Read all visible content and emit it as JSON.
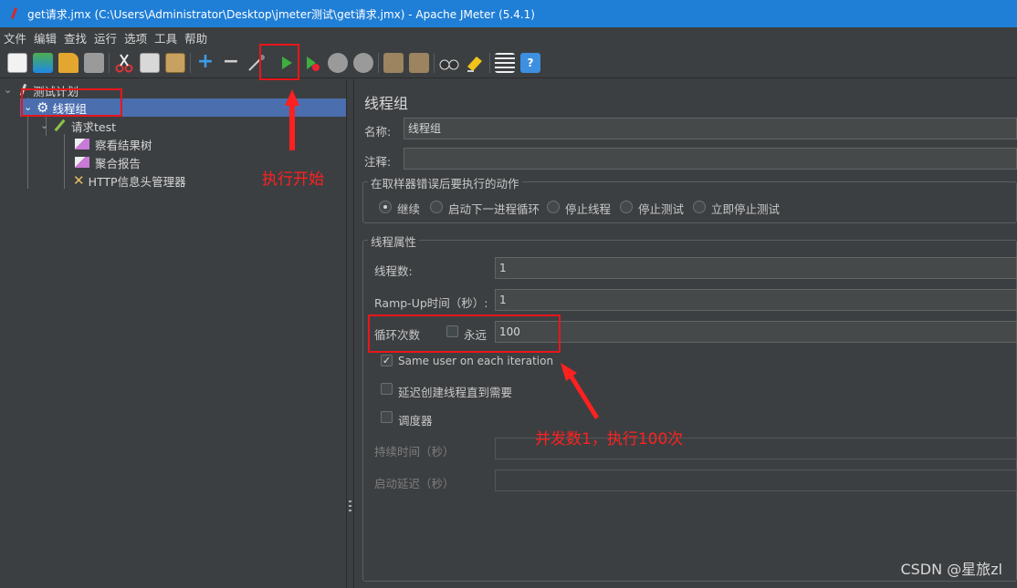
{
  "window": {
    "title": "get请求.jmx (C:\\Users\\Administrator\\Desktop\\jmeter测试\\get请求.jmx) - Apache JMeter (5.4.1)"
  },
  "menu": [
    "文件",
    "编辑",
    "查找",
    "运行",
    "选项",
    "工具",
    "帮助"
  ],
  "toolbar": {
    "buttons": [
      "new-icon",
      "templates-icon",
      "open-icon",
      "save-icon",
      "cut-icon",
      "copy-icon",
      "paste-icon",
      "expand-icon",
      "collapse-icon",
      "toggle-icon",
      "start-icon",
      "start-no-pause-icon",
      "stop-icon",
      "shutdown-icon",
      "clear-icon",
      "clear-all-icon",
      "search-icon",
      "reset-search-icon",
      "function-helper-icon",
      "help-icon"
    ]
  },
  "tree": {
    "root": "测试计划",
    "thread_group": "线程组",
    "sampler": "请求test",
    "children": [
      "察看结果树",
      "聚合报告",
      "HTTP信息头管理器"
    ]
  },
  "panel": {
    "title": "线程组",
    "name_label": "名称:",
    "name_value": "线程组",
    "comment_label": "注释:",
    "comment_value": "",
    "error_group_title": "在取样器错误后要执行的动作",
    "error_actions": [
      "继续",
      "启动下一进程循环",
      "停止线程",
      "停止测试",
      "立即停止测试"
    ],
    "selected_action": "继续",
    "props_group_title": "线程属性",
    "threads_label": "线程数:",
    "threads_value": "1",
    "rampup_label": "Ramp-Up时间（秒）:",
    "rampup_value": "1",
    "loop_label": "循环次数",
    "forever_label": "永远",
    "forever_checked": false,
    "loop_value": "100",
    "same_user_label": "Same user on each iteration",
    "same_user_checked": true,
    "delay_label": "延迟创建线程直到需要",
    "delay_checked": false,
    "scheduler_label": "调度器",
    "scheduler_checked": false,
    "duration_label": "持续时间（秒）",
    "duration_value": "",
    "startup_delay_label": "启动延迟（秒）",
    "startup_delay_value": ""
  },
  "annotations": {
    "start": "执行开始",
    "concurrency": "并发数1，执行100次",
    "color": "#ff2020"
  },
  "watermark": "CSDN @星旅zl",
  "colors": {
    "titlebar": "#1f7ed6",
    "background": "#3c3f41",
    "selection": "#4b6eaf",
    "start_green": "#3fae3f"
  }
}
